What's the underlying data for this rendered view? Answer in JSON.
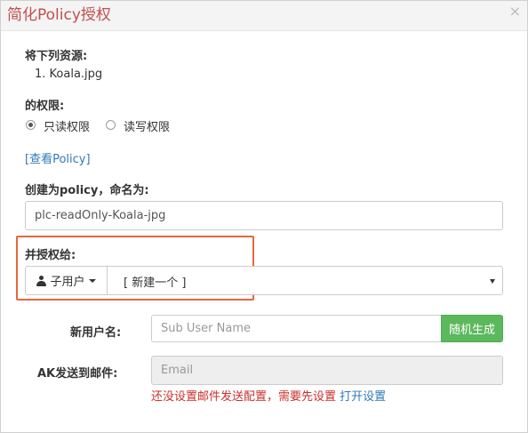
{
  "dialog": {
    "title": "简化Policy授权",
    "close_symbol": "×"
  },
  "resources": {
    "label": "将下列资源:",
    "items": [
      "1. Koala.jpg"
    ]
  },
  "permission": {
    "label": "的权限:",
    "options": [
      {
        "label": "只读权限",
        "checked": true
      },
      {
        "label": "读写权限",
        "checked": false
      }
    ]
  },
  "view_policy_link": "[查看Policy]",
  "policy_name": {
    "label": "创建为policy，命名为:",
    "value": "plc-readOnly-Koala-jpg"
  },
  "grant": {
    "label": "并授权给:",
    "type_button": "子用户",
    "type_icon": "user-icon",
    "selected": "[ 新建一个 ]"
  },
  "new_user": {
    "label": "新用户名:",
    "placeholder": "Sub User Name",
    "generate_button": "随机生成"
  },
  "ak_email": {
    "label": "AK发送到邮件:",
    "placeholder": "Email",
    "warning": "还没设置邮件发送配置，需要先设置",
    "warning_link": "打开设置"
  },
  "colors": {
    "title": "#c0504d",
    "highlight_border": "#e8663d",
    "button_green": "#5cb85c",
    "link": "#337ab7",
    "warning": "#c9302c"
  }
}
